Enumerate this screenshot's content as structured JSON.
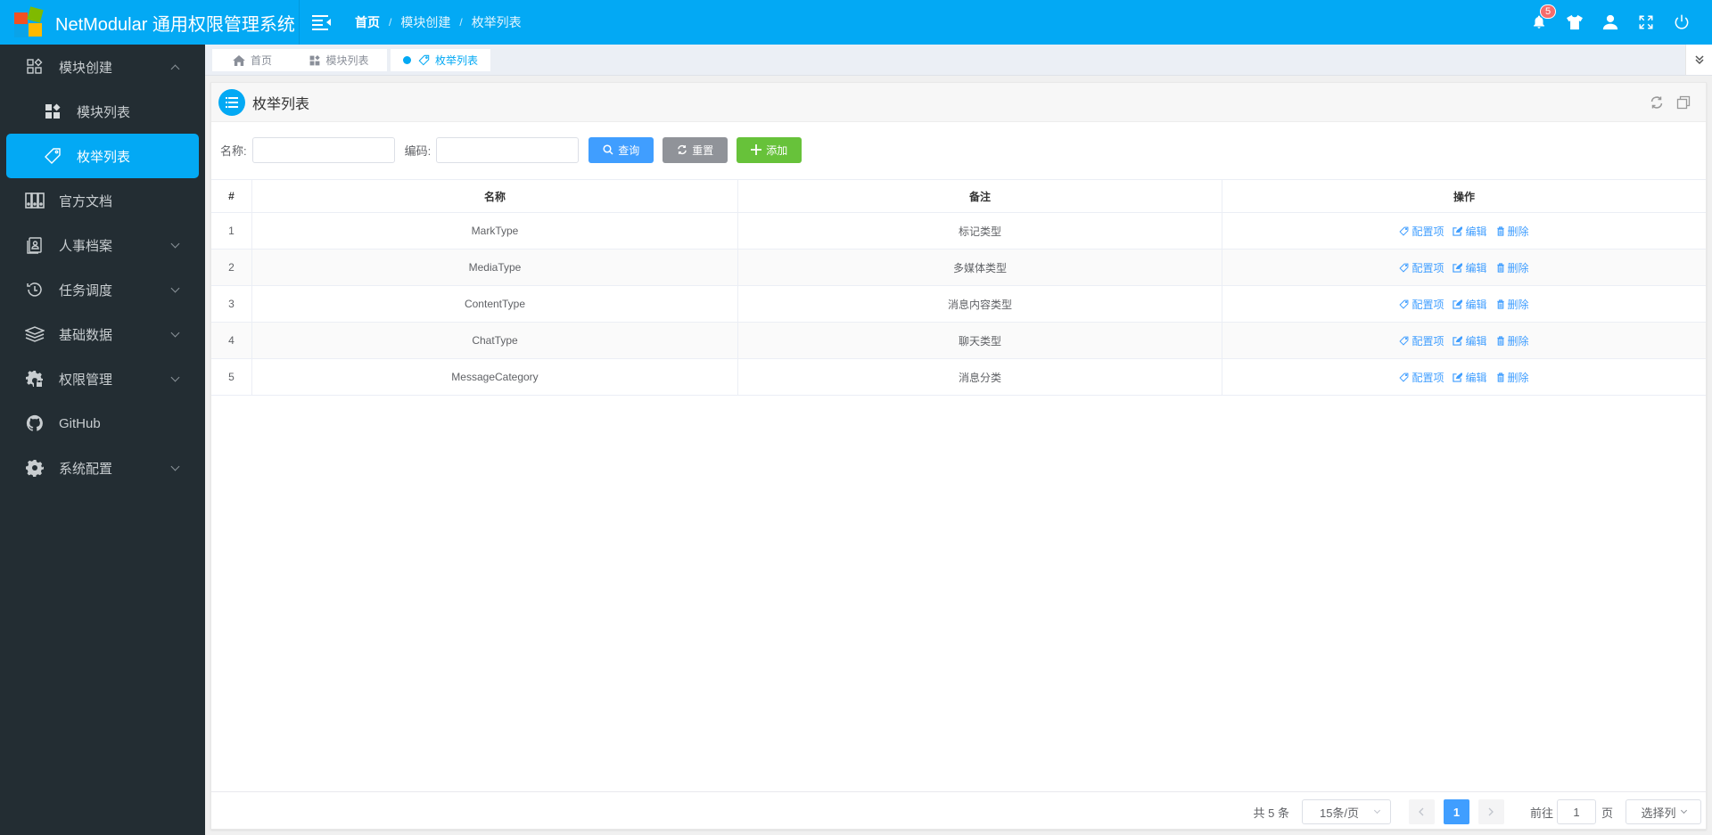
{
  "header": {
    "app_title": "NetModular 通用权限管理系统",
    "breadcrumb": [
      "首页",
      "模块创建",
      "枚举列表"
    ],
    "breadcrumb_separator": "/",
    "notification_count": "5",
    "icons": [
      "bell-icon",
      "skin-icon",
      "user-icon",
      "fullscreen-icon",
      "power-icon"
    ]
  },
  "sidebar": {
    "items": [
      {
        "label": "模块创建",
        "icon": "modules-icon",
        "expanded": true,
        "children": [
          {
            "label": "模块列表",
            "icon": "module-list-icon"
          },
          {
            "label": "枚举列表",
            "icon": "tag-icon",
            "active": true
          }
        ]
      },
      {
        "label": "官方文档",
        "icon": "docs-icon"
      },
      {
        "label": "人事档案",
        "icon": "personnel-icon",
        "has_children": true
      },
      {
        "label": "任务调度",
        "icon": "history-icon",
        "has_children": true
      },
      {
        "label": "基础数据",
        "icon": "layers-icon",
        "has_children": true
      },
      {
        "label": "权限管理",
        "icon": "gear-lock-icon",
        "has_children": true
      },
      {
        "label": "GitHub",
        "icon": "github-icon"
      },
      {
        "label": "系统配置",
        "icon": "settings-icon",
        "has_children": true
      }
    ]
  },
  "tabs": [
    {
      "label": "首页",
      "icon": "home-icon"
    },
    {
      "label": "模块列表",
      "icon": "module-list-icon"
    },
    {
      "label": "枚举列表",
      "icon": "tag-icon",
      "active": true
    }
  ],
  "card": {
    "title": "枚举列表"
  },
  "filter": {
    "name_label": "名称:",
    "name_value": "",
    "code_label": "编码:",
    "code_value": "",
    "query_label": "查询",
    "reset_label": "重置",
    "add_label": "添加"
  },
  "table": {
    "columns": [
      "#",
      "名称",
      "备注",
      "操作"
    ],
    "rows": [
      {
        "index": "1",
        "name": "MarkType",
        "remarks": "标记类型"
      },
      {
        "index": "2",
        "name": "MediaType",
        "remarks": "多媒体类型"
      },
      {
        "index": "3",
        "name": "ContentType",
        "remarks": "消息内容类型"
      },
      {
        "index": "4",
        "name": "ChatType",
        "remarks": "聊天类型"
      },
      {
        "index": "5",
        "name": "MessageCategory",
        "remarks": "消息分类"
      }
    ],
    "actions": {
      "config": "配置项",
      "edit": "编辑",
      "delete": "删除"
    }
  },
  "pagination": {
    "total_text": "共 5 条",
    "page_size": "15条/页",
    "current_page": "1",
    "goto_prefix": "前往",
    "goto_value": "1",
    "goto_suffix": "页",
    "columns_select": "选择列"
  },
  "colors": {
    "primary": "#03a9f4",
    "sidebar_bg": "#232d33",
    "link": "#409eff",
    "success": "#67c23a",
    "info": "#909399",
    "badge": "#f56c6c"
  }
}
